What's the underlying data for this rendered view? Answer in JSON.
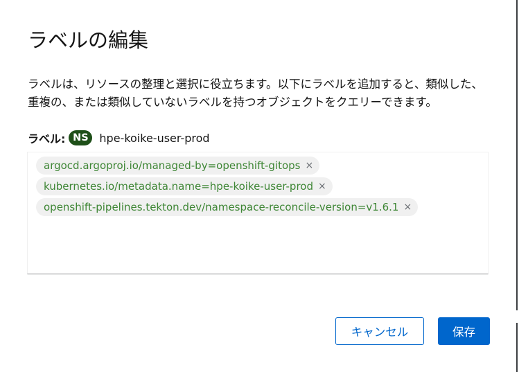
{
  "dialog": {
    "title": "ラベルの編集",
    "description": "ラベルは、リソースの整理と選択に役立ちます。以下にラベルを追加すると、類似した、重複の、または類似していないラベルを持つオブジェクトをクエリーできます。"
  },
  "label_field": {
    "heading": "ラベル:",
    "badge": "NS",
    "resource_name": "hpe-koike-user-prod"
  },
  "labels": [
    {
      "text": "argocd.argoproj.io/managed-by=openshift-gitops",
      "remove": "×"
    },
    {
      "text": "kubernetes.io/metadata.name=hpe-koike-user-prod",
      "remove": "×"
    },
    {
      "text": "openshift-pipelines.tekton.dev/namespace-reconcile-version=v1.6.1",
      "remove": "×"
    }
  ],
  "actions": {
    "cancel_label": "キャンセル",
    "save_label": "保存"
  },
  "colors": {
    "primary": "#0066cc",
    "badge_bg": "#1e4f18",
    "chip_text": "#3e8635",
    "chip_bg": "#f0f0f0"
  }
}
